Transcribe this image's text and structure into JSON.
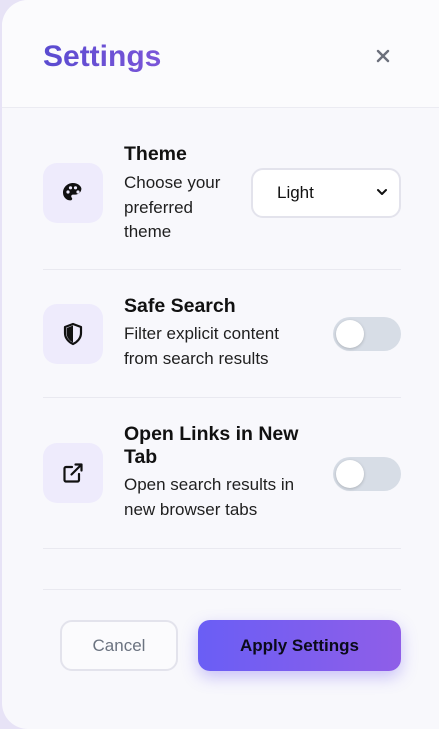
{
  "header": {
    "title": "Settings",
    "close_icon": "close-icon"
  },
  "settings": [
    {
      "title": "Theme",
      "description_lines": [
        "Choose your",
        "preferred",
        "theme"
      ],
      "icon": "palette-icon",
      "control": "select",
      "value": "Light"
    },
    {
      "title": "Safe Search",
      "description_lines": [
        "Filter explicit content",
        "from search results"
      ],
      "icon": "shield-icon",
      "control": "toggle",
      "enabled": false
    },
    {
      "title_lines": [
        "Open Links in New",
        "Tab"
      ],
      "description_lines": [
        "Open search results in",
        "new browser tabs"
      ],
      "icon": "external-link-icon",
      "control": "toggle",
      "enabled": false
    }
  ],
  "footer": {
    "cancel_label": "Cancel",
    "apply_label": "Apply Settings"
  },
  "colors": {
    "accent": "#5b4fcf",
    "button_gradient_start": "#6a5ef5",
    "button_gradient_end": "#8f5ee8",
    "icon_bg": "#eeebfc",
    "toggle_off": "#d7dde6"
  }
}
